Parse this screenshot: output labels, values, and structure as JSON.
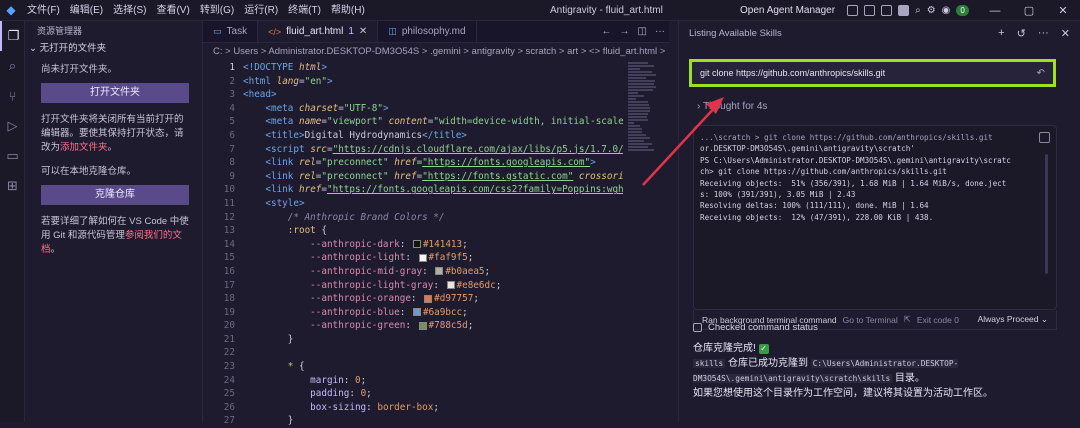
{
  "titlebar": {
    "menu": [
      "文件(F)",
      "编辑(E)",
      "选择(S)",
      "查看(V)",
      "转到(G)",
      "运行(R)",
      "终端(T)",
      "帮助(H)"
    ],
    "title": "Antigravity - fluid_art.html",
    "agent_manager": "Open Agent Manager",
    "badge": "0"
  },
  "sidebar": {
    "title": "资源管理器",
    "section": "无打开的文件夹",
    "no_folder": "尚未打开文件夹。",
    "open_folder_btn": "打开文件夹",
    "info1": "打开文件夹将关闭所有当前打开的编辑器。要使其保持打开状态，请改为",
    "info1_link": "添加文件夹",
    "info1_end": "。",
    "clone_hint": "可以在本地克隆仓库。",
    "clone_btn": "克隆仓库",
    "info2": "若要详细了解如何在 VS Code 中使用 Git 和源代码管理",
    "info2_link": "参阅我们的文档",
    "info2_end": "。"
  },
  "editor": {
    "tabs": [
      {
        "label": "Task"
      },
      {
        "label": "fluid_art.html",
        "mod": "1"
      },
      {
        "label": "philosophy.md"
      }
    ],
    "breadcrumb": "C: > Users > Administrator.DESKTOP-DM3O54S > .gemini > antigravity > scratch > art > <> fluid_art.html > ..."
  },
  "agent": {
    "header": "Listing Available Skills",
    "command": "git clone https://github.com/anthropics/skills.git",
    "thought": "Thought for 4s",
    "terminal": [
      "...\\scratch > git clone https://github.com/anthropics/skills.git",
      "or.DESKTOP-DM3O54S\\.gemini\\antigravity\\scratch'",
      "PS C:\\Users\\Administrator.DESKTOP-DM3O54S\\.gemini\\antigravity\\scratc",
      "ch> git clone https://github.com/anthropics/skills.git",
      "",
      "",
      "",
      "",
      "Receiving objects:  51% (356/391), 1.68 MiB | 1.64 MiB/s, done.ject",
      "s: 100% (391/391), 3.05 MiB | 2.43",
      "Resolving deltas: 100% (111/111), done. MiB | 1.64",
      "Receiving objects:  12% (47/391), 228.00 KiB | 438."
    ],
    "runbar": {
      "label": "Ran background terminal command",
      "goto": "Go to Terminal",
      "exit": "Exit code 0",
      "mode": "Always Proceed"
    },
    "checked": "Checked command status",
    "answer_title": "仓库克隆完成!",
    "answer_mono1": "skills",
    "answer_mid": " 仓库已成功克隆到 ",
    "answer_mono2": "C:\\Users\\Administrator.DESKTOP-DM3O54S\\.gemini\\antigravity\\scratch\\skills",
    "answer_end": " 目录。",
    "answer_last": "如果您想使用这个目录作为工作空间，建议将其设置为活动工作区。"
  }
}
